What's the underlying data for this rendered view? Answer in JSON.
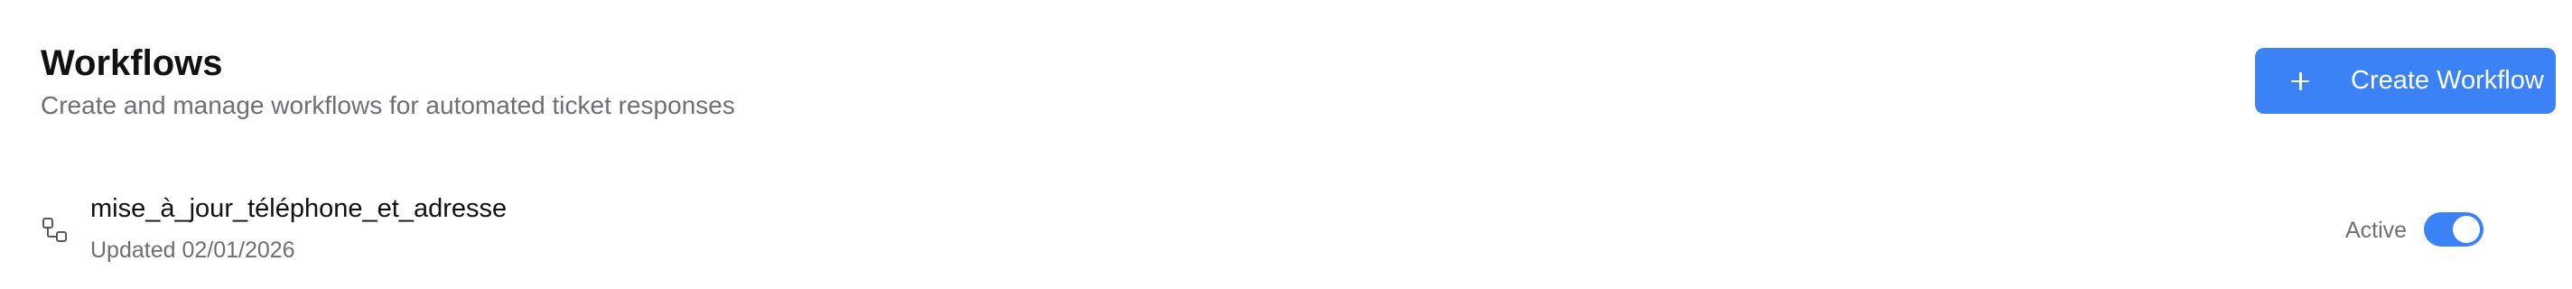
{
  "header": {
    "title": "Workflows",
    "subtitle": "Create and manage workflows for automated ticket responses"
  },
  "actions": {
    "create_label": "Create Workflow",
    "create_icon": "plus-icon"
  },
  "workflows": [
    {
      "name": "mise_à_jour_téléphone_et_adresse",
      "updated": "Updated 02/01/2026",
      "status_label": "Active",
      "active": true,
      "icon": "workflow-icon"
    }
  ],
  "colors": {
    "accent": "#3b82f6",
    "muted_text": "#6b6f76",
    "primary_text": "#111111"
  }
}
